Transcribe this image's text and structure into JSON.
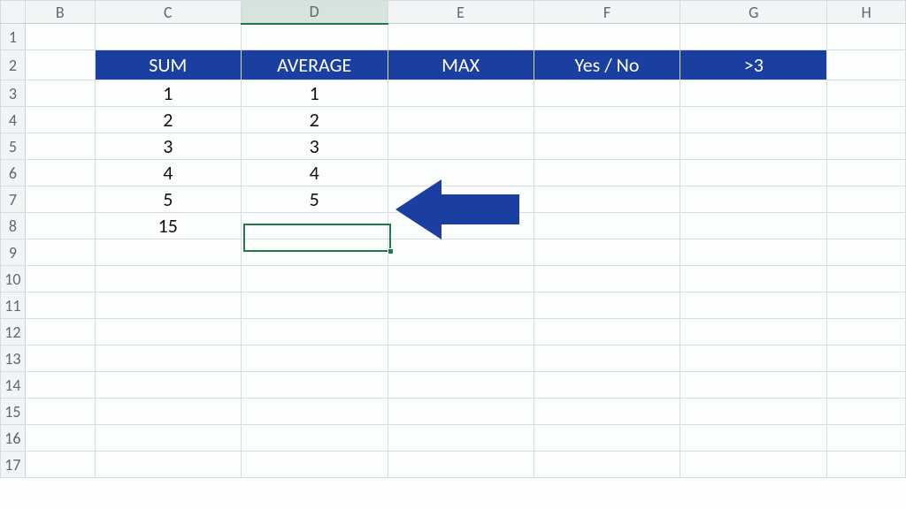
{
  "columns": {
    "B": "B",
    "C": "C",
    "D": "D",
    "E": "E",
    "F": "F",
    "G": "G",
    "H": "H"
  },
  "rows": {
    "r1": "1",
    "r2": "2",
    "r3": "3",
    "r4": "4",
    "r5": "5",
    "r6": "6",
    "r7": "7",
    "r8": "8",
    "r9": "9",
    "r10": "10",
    "r11": "11",
    "r12": "12",
    "r13": "13",
    "r14": "14",
    "r15": "15",
    "r16": "16",
    "r17": "17"
  },
  "table": {
    "headers": {
      "C": "SUM",
      "D": "AVERAGE",
      "E": "MAX",
      "F": "Yes / No",
      "G": ">3"
    },
    "data": {
      "C": [
        "1",
        "2",
        "3",
        "4",
        "5"
      ],
      "D": [
        "1",
        "2",
        "3",
        "4",
        "5"
      ],
      "E": [
        "",
        "",
        "",
        "",
        ""
      ],
      "F": [
        "",
        "",
        "",
        "",
        ""
      ],
      "G": [
        "",
        "",
        "",
        "",
        ""
      ]
    },
    "totals": {
      "C": "15",
      "D": "",
      "E": "",
      "F": "",
      "G": ""
    }
  },
  "active_cell": "D8",
  "chart_data": {
    "type": "table",
    "title": "",
    "columns": [
      "SUM",
      "AVERAGE",
      "MAX",
      "Yes / No",
      ">3"
    ],
    "rows": [
      [
        1,
        1,
        null,
        null,
        null
      ],
      [
        2,
        2,
        null,
        null,
        null
      ],
      [
        3,
        3,
        null,
        null,
        null
      ],
      [
        4,
        4,
        null,
        null,
        null
      ],
      [
        5,
        5,
        null,
        null,
        null
      ],
      [
        15,
        null,
        null,
        null,
        null
      ]
    ]
  }
}
